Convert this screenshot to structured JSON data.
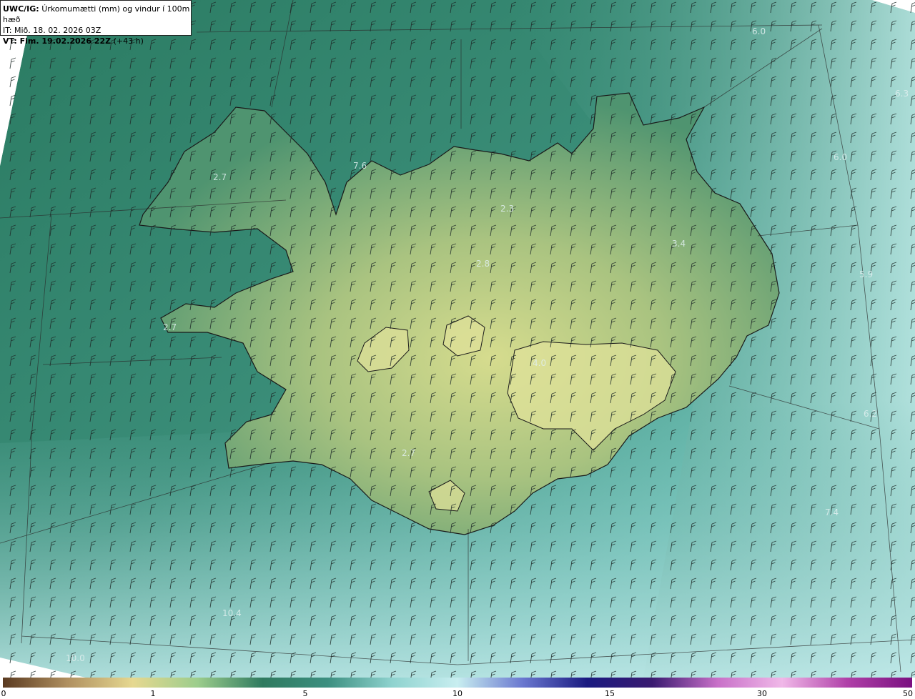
{
  "header": {
    "product": "UWC/IG:",
    "description": "Úrkomumætti (mm) og vindur í 100m hæð",
    "issue_time": "IT: Mið. 18. 02. 2026 03Z",
    "valid_label": "VT: Fim. 19.02.2026 22Z",
    "lead_time": "(+43 h)"
  },
  "map": {
    "region": "Iceland",
    "colors": {
      "sea_low": "#1f6b5a",
      "sea_high": "#9fd8d8",
      "land_low": "#3f8a6a",
      "land_high": "#d7dc8c",
      "coast": "#1a1a1a",
      "grid": "#2a2a2a"
    },
    "value_labels": [
      "2.7",
      "7.6",
      "2.3",
      "3.4",
      "6.0",
      "5.9",
      "2.8",
      "2.7",
      "4.0",
      "6.2",
      "2.7",
      "7.4",
      "10.4",
      "10.0",
      "6.0",
      "6.3"
    ]
  },
  "colorbar": {
    "ticks": [
      "0",
      "1",
      "5",
      "10",
      "15",
      "30",
      "50"
    ],
    "colors": [
      "#5a3a20",
      "#b09060",
      "#e6d890",
      "#9ccd8c",
      "#2f7a5f",
      "#3c8f80",
      "#8fd3cf",
      "#c8eef0",
      "#6a78d0",
      "#1a1a80",
      "#3a1a70",
      "#c870c8",
      "#f0b8e8",
      "#b040a8",
      "#7a1080"
    ]
  }
}
